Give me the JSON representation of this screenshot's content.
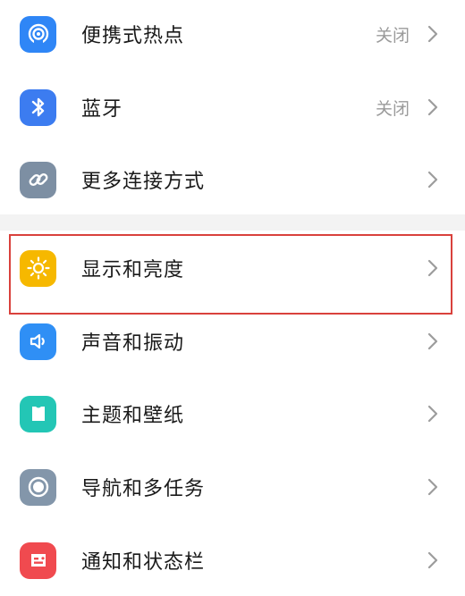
{
  "settings": {
    "items": [
      {
        "label": "便携式热点",
        "status": "关闭",
        "icon": "hotspot-icon",
        "color": "#2f86f6"
      },
      {
        "label": "蓝牙",
        "status": "关闭",
        "icon": "bluetooth-icon",
        "color": "#3c7cf0"
      },
      {
        "label": "更多连接方式",
        "status": "",
        "icon": "link-icon",
        "color": "#7d8fa3"
      },
      {
        "label": "显示和亮度",
        "status": "",
        "icon": "brightness-icon",
        "color": "#f6b800"
      },
      {
        "label": "声音和振动",
        "status": "",
        "icon": "volume-icon",
        "color": "#2f8ff5"
      },
      {
        "label": "主题和壁纸",
        "status": "",
        "icon": "theme-icon",
        "color": "#23c6b5"
      },
      {
        "label": "导航和多任务",
        "status": "",
        "icon": "navigation-icon",
        "color": "#8396aa"
      },
      {
        "label": "通知和状态栏",
        "status": "",
        "icon": "notification-icon",
        "color": "#f04a4f"
      }
    ]
  }
}
